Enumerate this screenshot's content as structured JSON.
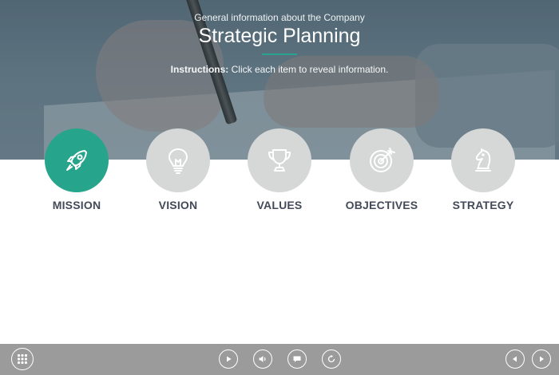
{
  "header": {
    "subtitle": "General information about the Company",
    "title": "Strategic Planning",
    "instructions_label": "Instructions:",
    "instructions_text": " Click each item to reveal information."
  },
  "items": [
    {
      "label": "MISSION",
      "icon": "rocket-icon",
      "active": true
    },
    {
      "label": "VISION",
      "icon": "lightbulb-icon",
      "active": false
    },
    {
      "label": "VALUES",
      "icon": "trophy-icon",
      "active": false
    },
    {
      "label": "OBJECTIVES",
      "icon": "target-icon",
      "active": false
    },
    {
      "label": "STRATEGY",
      "icon": "chess-knight-icon",
      "active": false
    }
  ],
  "toolbar": {
    "buttons": [
      "menu-grid-icon",
      "play-icon",
      "volume-icon",
      "captions-icon",
      "replay-icon",
      "previous-icon",
      "next-icon"
    ]
  },
  "colors": {
    "accent": "#27a58c",
    "inactive_circle": "#d6d7d7",
    "label_text": "#434a58",
    "toolbar_bg": "#9b9b9b"
  }
}
